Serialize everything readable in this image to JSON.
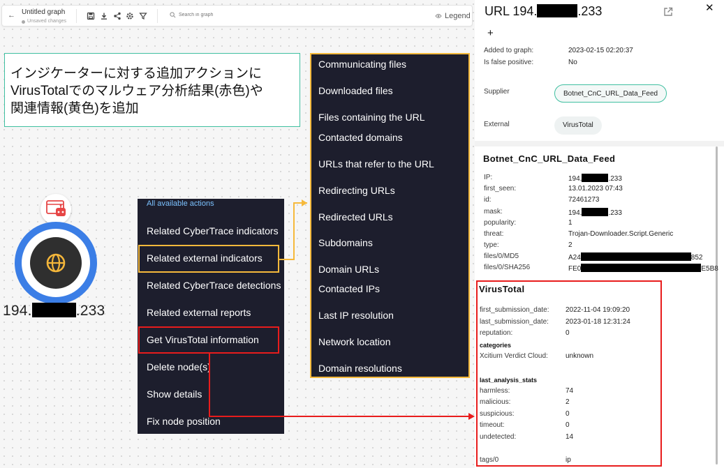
{
  "toolbar": {
    "back_glyph": "←",
    "title": "Untitled graph",
    "status": "Unsaved changes",
    "search_placeholder": "Search in graph",
    "legend_label": "Legend",
    "icons": [
      "save-icon",
      "download-icon",
      "share-icon",
      "settings-icon",
      "filter-icon"
    ]
  },
  "annotation": {
    "lines": [
      "インジケーターに対する追加アクションに",
      "VirusTotalでのマルウェア分析結果(赤色)や",
      "関連情報(黄色)を追加"
    ]
  },
  "node": {
    "label_prefix": "194.",
    "label_suffix": ".233",
    "ring_color": "#3b7ee6",
    "badge_icon": "robot-alert-icon",
    "core_icon": "globe-icon"
  },
  "actions_menu": {
    "header": "All available actions",
    "items": [
      "Related CyberTrace indicators",
      "Related external indicators",
      "Related CyberTrace detections",
      "Related external reports",
      "Get VirusTotal information",
      "Delete node(s)",
      "Show details",
      "Fix node position"
    ]
  },
  "sub_menu": {
    "items": [
      "Communicating files",
      "Downloaded files",
      "Files containing the URL",
      "Contacted domains",
      "URLs that refer to the URL",
      "Redirecting URLs",
      "Redirected URLs",
      "Subdomains",
      "Domain URLs",
      "Contacted IPs",
      "Last IP resolution",
      "Network location",
      "Domain resolutions"
    ]
  },
  "panel": {
    "title_prefix": "URL 194.",
    "title_suffix": ".233",
    "close_glyph": "✕",
    "add_glyph": "+",
    "added_label": "Added to graph:",
    "added_value": "2023-02-15 02:20:37",
    "false_positive_label": "Is false positive:",
    "false_positive_value": "No",
    "supplier_label": "Supplier",
    "supplier_value": "Botnet_CnC_URL_Data_Feed",
    "external_label": "External",
    "external_value": "VirusTotal",
    "feed": {
      "title": "Botnet_CnC_URL_Data_Feed",
      "ip_label": "IP:",
      "ip_prefix": "194.",
      "ip_suffix": ".233",
      "first_seen_label": "first_seen:",
      "first_seen_value": "13.01.2023 07:43",
      "id_label": "id:",
      "id_value": "72461273",
      "mask_label": "mask:",
      "mask_prefix": "194.",
      "mask_suffix": ".233",
      "popularity_label": "popularity:",
      "popularity_value": "1",
      "threat_label": "threat:",
      "threat_value": "Trojan-Downloader.Script.Generic",
      "type_label": "type:",
      "type_value": "2",
      "md5_label": "files/0/MD5",
      "md5_prefix": "A24",
      "md5_suffix": "852",
      "sha_label": "files/0/SHA256",
      "sha_prefix": "FE0",
      "sha_suffix": "E5B8"
    },
    "vt": {
      "title": "VirusTotal",
      "first_sub_label": "first_submission_date:",
      "first_sub_value": "2022-11-04 19:09:20",
      "last_sub_label": "last_submission_date:",
      "last_sub_value": "2023-01-18 12:31:24",
      "reputation_label": "reputation:",
      "reputation_value": "0",
      "categories_label": "categories",
      "xcitium_label": "Xcitium Verdict Cloud:",
      "xcitium_value": "unknown",
      "stats_label": "last_analysis_stats",
      "harmless_label": "harmless:",
      "harmless_value": "74",
      "malicious_label": "malicious:",
      "malicious_value": "2",
      "suspicious_label": "suspicious:",
      "suspicious_value": "0",
      "timeout_label": "timeout:",
      "timeout_value": "0",
      "undetected_label": "undetected:",
      "undetected_value": "14",
      "tags_label": "tags/0",
      "tags_value": "ip"
    }
  },
  "colors": {
    "highlight_yellow": "#f6b93b",
    "highlight_red": "#e81c1c",
    "annotation_border": "#3fbfa0",
    "menu_bg": "#1d1e2d",
    "menu_header": "#7cc2ff"
  }
}
